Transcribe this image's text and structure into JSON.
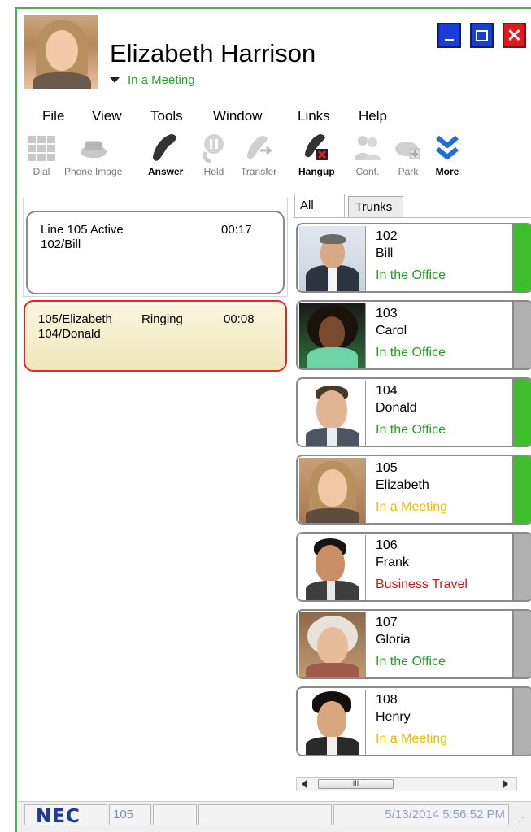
{
  "user": {
    "name": "Elizabeth Harrison",
    "status": "In a Meeting"
  },
  "menu": [
    "File",
    "View",
    "Tools",
    "Window",
    "Links",
    "Help"
  ],
  "toolbar": [
    {
      "label": "Dial",
      "icon": "dialpad-icon",
      "enabled": false
    },
    {
      "label": "Phone Image",
      "icon": "phone-image-icon",
      "enabled": false
    },
    {
      "label": "Answer",
      "icon": "answer-phone-icon",
      "enabled": true
    },
    {
      "label": "Hold",
      "icon": "hold-icon",
      "enabled": false
    },
    {
      "label": "Transfer",
      "icon": "transfer-icon",
      "enabled": false
    },
    {
      "label": "Hangup",
      "icon": "hangup-icon",
      "enabled": true
    },
    {
      "label": "Conf.",
      "icon": "conference-icon",
      "enabled": false
    },
    {
      "label": "Park",
      "icon": "park-icon",
      "enabled": false
    },
    {
      "label": "More",
      "icon": "double-chevron-down-icon",
      "enabled": true
    }
  ],
  "calls": [
    {
      "line1_left": "Line 105 Active",
      "line1_right": "00:17",
      "line2": "102/Bill"
    },
    {
      "line1_left": "105/Elizabeth",
      "line1_mid": "Ringing",
      "line1_right": "00:08",
      "line2": "104/Donald"
    }
  ],
  "tabs": [
    "All",
    "Trunks"
  ],
  "contacts": [
    {
      "ext": "102",
      "name": "Bill",
      "status": "In the Office",
      "status_color": "#22a022",
      "bar_color": "#3cbf2a"
    },
    {
      "ext": "103",
      "name": "Carol",
      "status": "In the Office",
      "status_color": "#22a022",
      "bar_color": "#b0b0b0"
    },
    {
      "ext": "104",
      "name": "Donald",
      "status": "In the Office",
      "status_color": "#22a022",
      "bar_color": "#3cbf2a"
    },
    {
      "ext": "105",
      "name": "Elizabeth",
      "status": "In a Meeting",
      "status_color": "#f0b800",
      "bar_color": "#3cbf2a"
    },
    {
      "ext": "106",
      "name": "Frank",
      "status": "Business Travel",
      "status_color": "#d01818",
      "bar_color": "#b0b0b0"
    },
    {
      "ext": "107",
      "name": "Gloria",
      "status": "In the Office",
      "status_color": "#22a022",
      "bar_color": "#b0b0b0"
    },
    {
      "ext": "108",
      "name": "Henry",
      "status": "In a Meeting",
      "status_color": "#f0b800",
      "bar_color": "#b0b0b0"
    }
  ],
  "scrollbar": {
    "thumb_text": "III"
  },
  "statusbar": {
    "brand": "NEC",
    "extension": "105",
    "datetime": "5/13/2014 5:56:52 PM"
  }
}
